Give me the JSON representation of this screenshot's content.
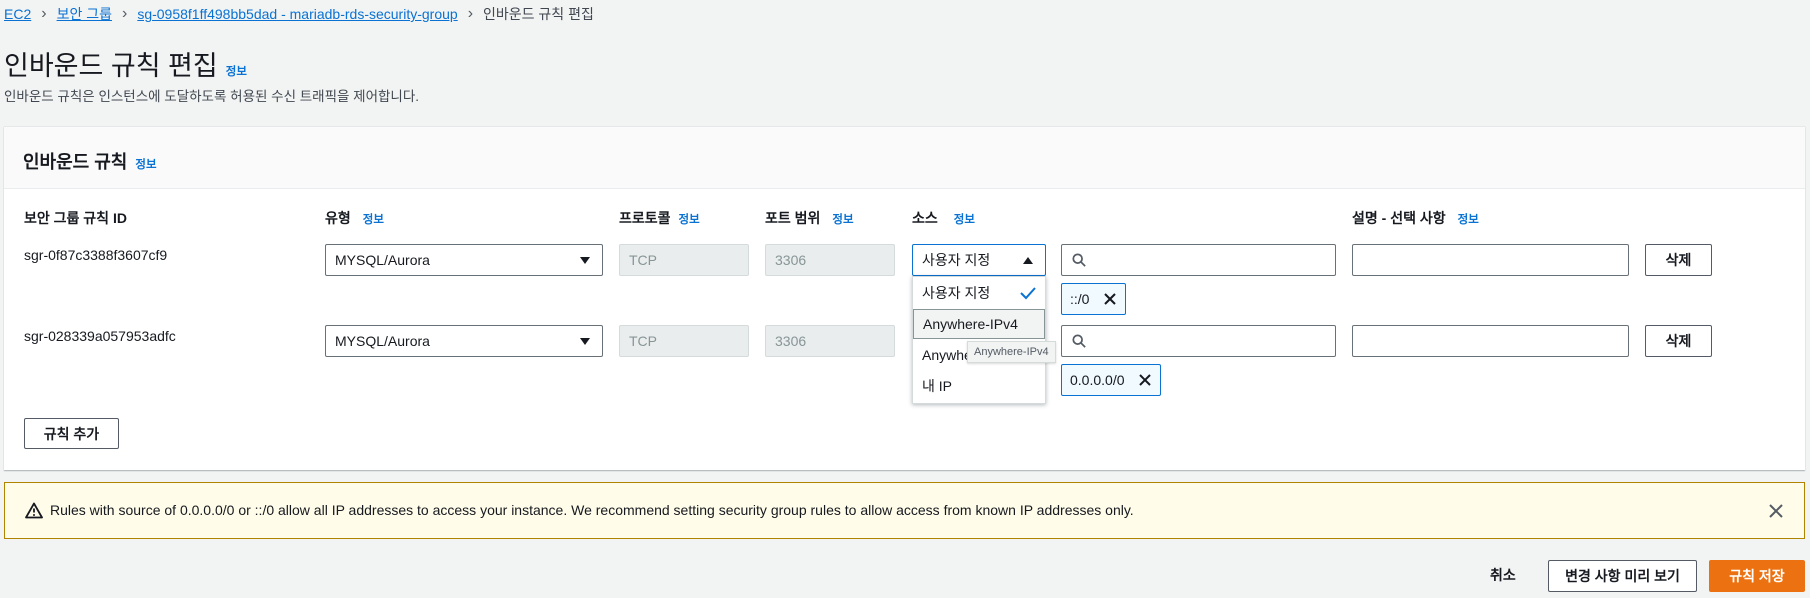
{
  "breadcrumb": {
    "items": [
      "EC2",
      "보안 그룹",
      "sg-0958f1ff498bb5dad - mariadb-rds-security-group"
    ],
    "current": "인바운드 규칙 편집"
  },
  "page": {
    "title": "인바운드 규칙 편집",
    "info": "정보",
    "subtitle": "인바운드 규칙은 인스턴스에 도달하도록 허용된 수신 트래픽을 제어합니다."
  },
  "panel": {
    "title": "인바운드 규칙",
    "info": "정보",
    "columns": {
      "rule_id": "보안 그룹 규칙 ID",
      "type": "유형",
      "protocol": "프로토콜",
      "port_range": "포트 범위",
      "source": "소스",
      "description": "설명 - 선택 사항",
      "info": "정보"
    },
    "rules": [
      {
        "id": "sgr-0f87c3388f3607cf9",
        "type": "MYSQL/Aurora",
        "protocol": "TCP",
        "port": "3306",
        "source_type": "사용자 지정",
        "token": "::/0",
        "delete": "삭제"
      },
      {
        "id": "sgr-028339a057953adfc",
        "type": "MYSQL/Aurora",
        "protocol": "TCP",
        "port": "3306",
        "source_type": "",
        "token": "0.0.0.0/0",
        "delete": "삭제"
      }
    ],
    "add_rule": "규칙 추가"
  },
  "source_dropdown": {
    "options": [
      "사용자 지정",
      "Anywhere-IPv4",
      "Anywhe",
      "내 IP"
    ],
    "selected": "사용자 지정",
    "hovered": "Anywhere-IPv4",
    "tooltip": "Anywhere-IPv4"
  },
  "alert": {
    "text": "Rules with source of 0.0.0.0/0 or ::/0 allow all IP addresses to access your instance. We recommend setting security group rules to allow access from known IP addresses only."
  },
  "footer": {
    "cancel": "취소",
    "preview": "변경 사항 미리 보기",
    "save": "규칙 저장"
  },
  "colors": {
    "link": "#0972d3",
    "primary_button": "#ec7211",
    "warning_border": "#b18400",
    "warning_bg": "#fffce9"
  }
}
